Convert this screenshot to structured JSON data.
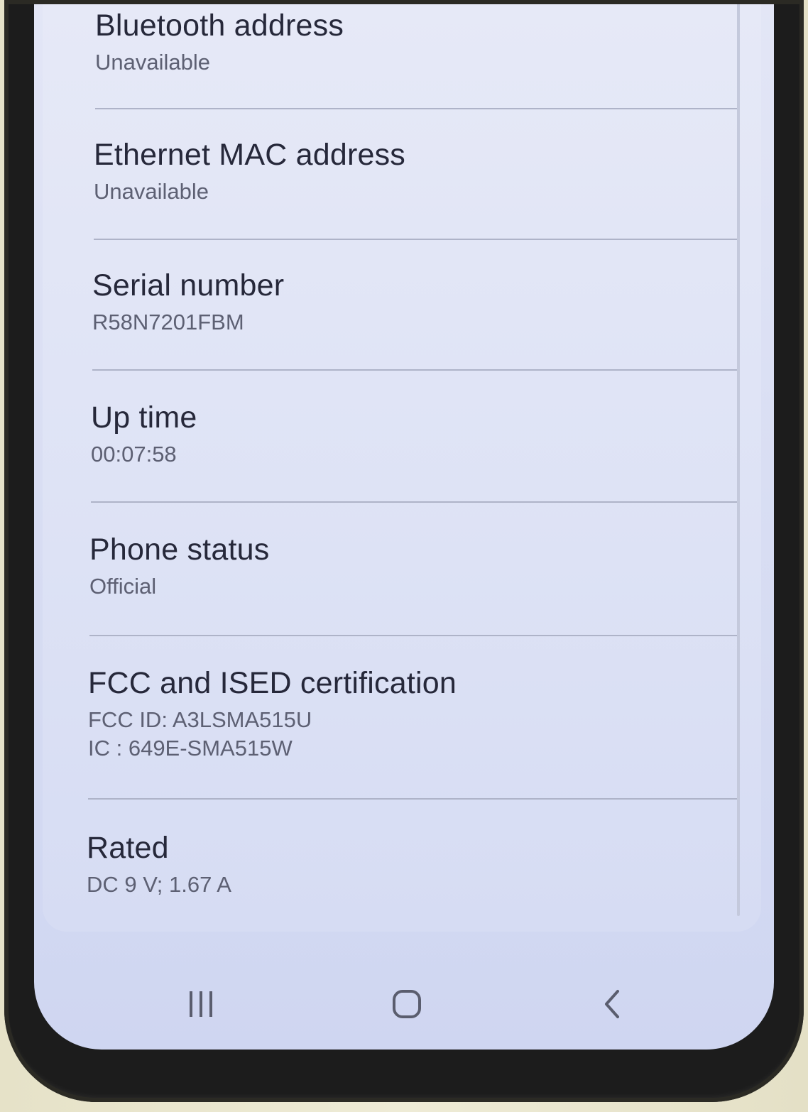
{
  "settings": {
    "items": [
      {
        "title": "Bluetooth address",
        "value": "Unavailable"
      },
      {
        "title": "Ethernet MAC address",
        "value": "Unavailable"
      },
      {
        "title": "Serial number",
        "value": "R58N7201FBM"
      },
      {
        "title": "Up time",
        "value": "00:07:58"
      },
      {
        "title": "Phone status",
        "value": "Official"
      },
      {
        "title": "FCC and ISED certification",
        "value": "FCC ID: A3LSMA515U",
        "value2": "IC : 649E-SMA515W"
      },
      {
        "title": "Rated",
        "value": "DC 9 V; 1.67 A"
      }
    ]
  },
  "navbar": {
    "recents_icon": "recent-apps-icon",
    "home_icon": "home-icon",
    "back_icon": "back-icon"
  },
  "colors": {
    "screen_bg": "#dde2f5",
    "title_text": "#26283a",
    "subtitle_text": "#5d6073",
    "divider": "#aeb3c8",
    "nav_icon": "#5a5d6e"
  }
}
